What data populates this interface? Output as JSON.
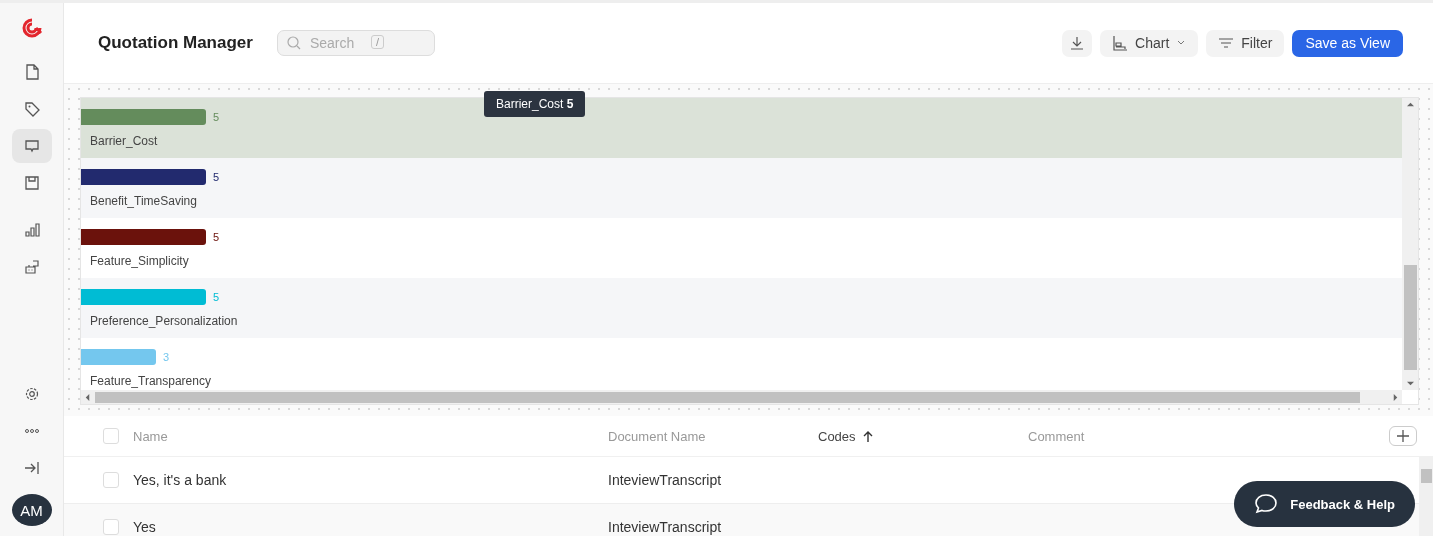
{
  "app": {
    "title": "Quotation Manager",
    "avatar": "AM"
  },
  "sidebar": {
    "items": [
      {
        "selected": false
      },
      {
        "selected": false
      },
      {
        "selected": true
      },
      {
        "selected": false
      },
      {
        "selected": false
      },
      {
        "selected": false
      }
    ]
  },
  "search": {
    "placeholder": "Search",
    "shortcut": "/"
  },
  "toolbar": {
    "chart": "Chart",
    "filter": "Filter",
    "save": "Save as View"
  },
  "codes": [
    {
      "label": "Barrier_Cost",
      "count": "5",
      "color": "#648c5c",
      "selected": true
    },
    {
      "label": "Benefit_TimeSaving",
      "count": "5",
      "color": "#222a6e",
      "selected": false
    },
    {
      "label": "Feature_Simplicity",
      "count": "5",
      "color": "#6b120c",
      "selected": false
    },
    {
      "label": "Preference_Personalization",
      "count": "5",
      "color": "#00bcd4",
      "selected": false
    },
    {
      "label": "Feature_Transparency",
      "count": "3",
      "color": "#74c7ee",
      "selected": false
    }
  ],
  "tooltip": {
    "label": "Barrier_Cost",
    "value": "5"
  },
  "table": {
    "all_checked": false,
    "columns": [
      {
        "label": "Name",
        "sorted": false
      },
      {
        "label": "Document Name",
        "sorted": false
      },
      {
        "label": "Codes",
        "sorted": true
      },
      {
        "label": "Comment",
        "sorted": false
      }
    ],
    "rows": [
      {
        "name": "Yes, it's a bank",
        "document": "InteviewTranscript",
        "checked": false
      },
      {
        "name": "Yes",
        "document": "InteviewTranscript",
        "checked": false
      }
    ]
  },
  "feedback": "Feedback & Help"
}
